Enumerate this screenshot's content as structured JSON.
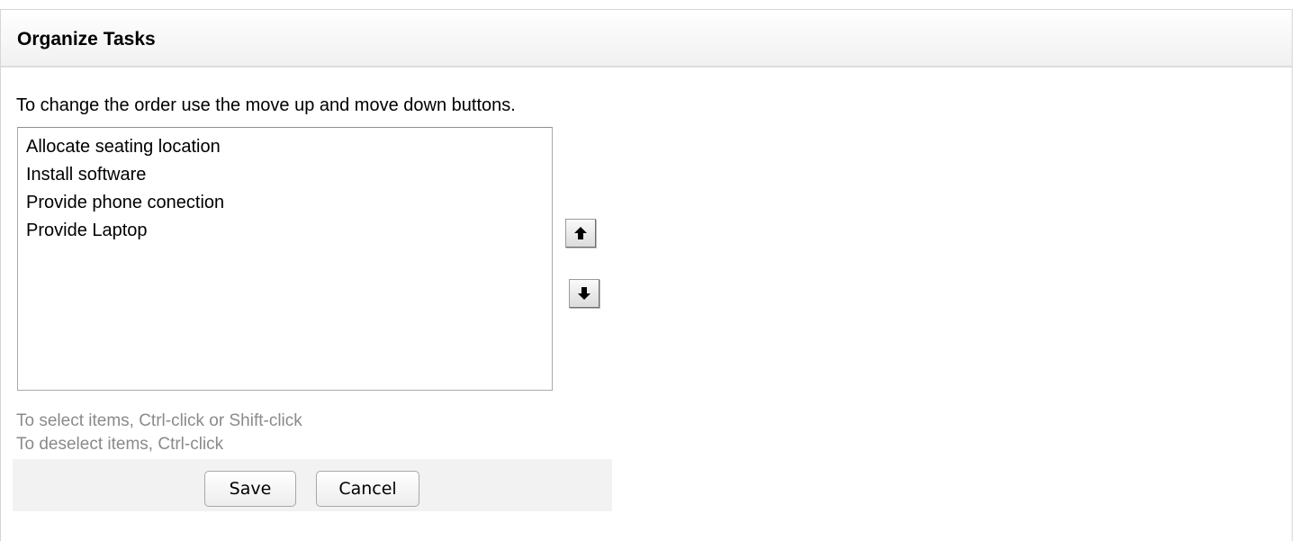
{
  "panel": {
    "title": "Organize Tasks"
  },
  "instructions": "To change the order use the move up and move down buttons.",
  "task_list": {
    "items": [
      "Allocate seating location",
      "Install software",
      "Provide phone conection",
      "Provide Laptop"
    ]
  },
  "controls": {
    "move_up_icon": "arrow-up-icon",
    "move_down_icon": "arrow-down-icon"
  },
  "hints": {
    "select": "To select items, Ctrl-click or Shift-click",
    "deselect": "To deselect items, Ctrl-click"
  },
  "buttons": {
    "save_label": "Save",
    "cancel_label": "Cancel"
  }
}
